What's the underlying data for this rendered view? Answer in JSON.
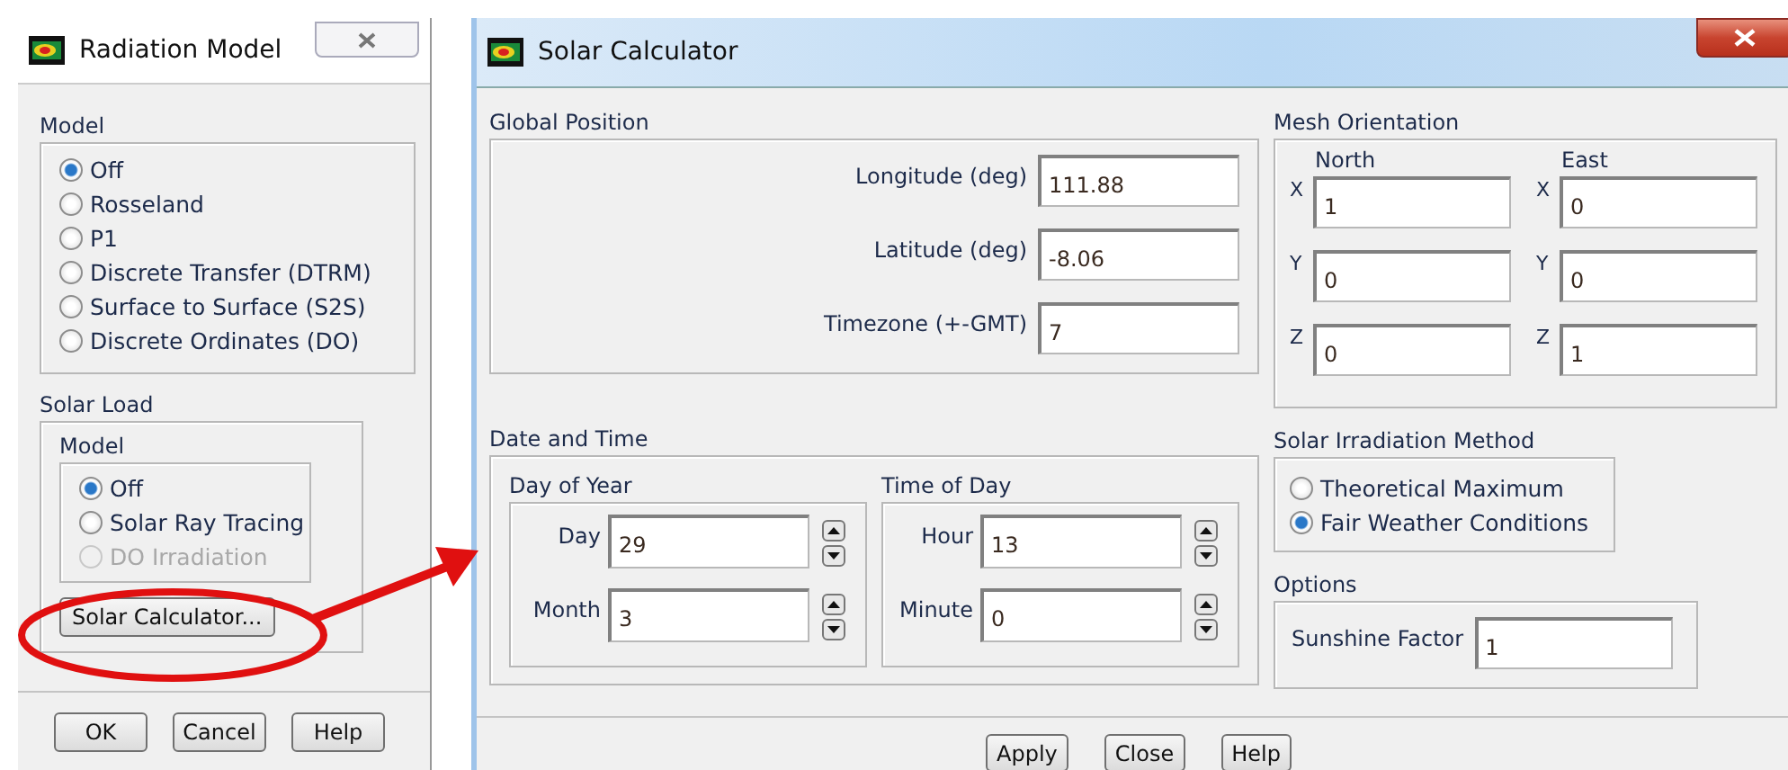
{
  "radiation_model": {
    "title": "Radiation Model",
    "model": {
      "label": "Model",
      "options": [
        {
          "label": "Off",
          "selected": true
        },
        {
          "label": "Rosseland",
          "selected": false
        },
        {
          "label": "P1",
          "selected": false
        },
        {
          "label": "Discrete Transfer (DTRM)",
          "selected": false
        },
        {
          "label": "Surface to Surface (S2S)",
          "selected": false
        },
        {
          "label": "Discrete Ordinates (DO)",
          "selected": false
        }
      ]
    },
    "solar_load": {
      "label": "Solar Load",
      "model": {
        "label": "Model",
        "options": [
          {
            "label": "Off",
            "selected": true,
            "disabled": false
          },
          {
            "label": "Solar Ray Tracing",
            "selected": false,
            "disabled": false
          },
          {
            "label": "DO Irradiation",
            "selected": false,
            "disabled": true
          }
        ]
      },
      "calculator_button": "Solar Calculator..."
    },
    "buttons": [
      "OK",
      "Cancel",
      "Help"
    ]
  },
  "solar_calculator": {
    "title": "Solar Calculator",
    "global_position": {
      "label": "Global Position",
      "fields": [
        {
          "label": "Longitude (deg)",
          "value": "111.88"
        },
        {
          "label": "Latitude (deg)",
          "value": "-8.06"
        },
        {
          "label": "Timezone (+-GMT)",
          "value": "7"
        }
      ]
    },
    "date_and_time": {
      "label": "Date and Time",
      "groups": [
        {
          "label": "Day of Year",
          "fields": [
            {
              "label": "Day",
              "value": "29"
            },
            {
              "label": "Month",
              "value": "3"
            }
          ]
        },
        {
          "label": "Time of Day",
          "fields": [
            {
              "label": "Hour",
              "value": "13"
            },
            {
              "label": "Minute",
              "value": "0"
            }
          ]
        }
      ]
    },
    "mesh_orientation": {
      "label": "Mesh Orientation",
      "columns": [
        {
          "label": "North",
          "fields": [
            {
              "axis": "X",
              "value": "1"
            },
            {
              "axis": "Y",
              "value": "0"
            },
            {
              "axis": "Z",
              "value": "0"
            }
          ]
        },
        {
          "label": "East",
          "fields": [
            {
              "axis": "X",
              "value": "0"
            },
            {
              "axis": "Y",
              "value": "0"
            },
            {
              "axis": "Z",
              "value": "1"
            }
          ]
        }
      ]
    },
    "irradiation_method": {
      "label": "Solar Irradiation Method",
      "options": [
        {
          "label": "Theoretical Maximum",
          "selected": false
        },
        {
          "label": "Fair Weather Conditions",
          "selected": true
        }
      ]
    },
    "options": {
      "label": "Options",
      "fields": [
        {
          "label": "Sunshine Factor",
          "value": "1"
        }
      ]
    },
    "buttons": [
      "Apply",
      "Close",
      "Help"
    ]
  }
}
